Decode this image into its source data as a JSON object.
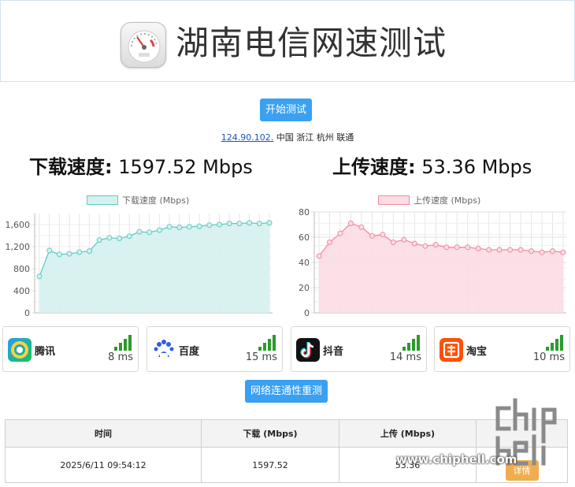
{
  "header": {
    "title": "湖南电信网速测试",
    "logo": "speedometer-icon"
  },
  "controls": {
    "start_label": "开始测试",
    "retest_label": "网络连通性重测"
  },
  "connection": {
    "ip": "124.90.102.",
    "info": "中国 浙江 杭州 联通"
  },
  "download": {
    "label": "下载速度:",
    "value": "1597.52 Mbps"
  },
  "upload": {
    "label": "上传速度:",
    "value": "53.36 Mbps"
  },
  "chart_data": [
    {
      "type": "area",
      "series": [
        {
          "name": "下载速度 (Mbps)",
          "values": [
            660,
            1130,
            1060,
            1070,
            1100,
            1120,
            1320,
            1360,
            1350,
            1390,
            1470,
            1460,
            1500,
            1560,
            1550,
            1560,
            1570,
            1590,
            1600,
            1620,
            1620,
            1630,
            1620,
            1630
          ]
        }
      ],
      "yticks": [
        "0",
        "400",
        "800",
        "1,200",
        "1,600"
      ],
      "ylim": [
        0,
        1800
      ],
      "grid": true,
      "color": "#5ecbc5",
      "fill": "#d5f1ef",
      "legend": "top"
    },
    {
      "type": "area",
      "series": [
        {
          "name": "上传速度 (Mbps)",
          "values": [
            45,
            56,
            63,
            71,
            68,
            61,
            62,
            56,
            58,
            55,
            53,
            54,
            52,
            52,
            52,
            51,
            50,
            50,
            50,
            50,
            49,
            48,
            49,
            48
          ]
        }
      ],
      "yticks": [
        "0",
        "20",
        "40",
        "60",
        "80"
      ],
      "ylim": [
        0,
        80
      ],
      "grid": true,
      "color": "#f18aa0",
      "fill": "#fbdde4",
      "legend": "top"
    }
  ],
  "latency": [
    {
      "name": "腾讯",
      "ms": "8 ms",
      "icon": "tencent-icon"
    },
    {
      "name": "百度",
      "ms": "15 ms",
      "icon": "baidu-icon"
    },
    {
      "name": "抖音",
      "ms": "14 ms",
      "icon": "douyin-icon"
    },
    {
      "name": "淘宝",
      "ms": "10 ms",
      "icon": "taobao-icon"
    }
  ],
  "history": {
    "headers": [
      "时间",
      "下载 (Mbps)",
      "上传 (Mbps)",
      ""
    ],
    "rows": [
      {
        "time": "2025/6/11 09:54:12",
        "download": "1597.52",
        "upload": "53.36",
        "action": "详情"
      }
    ]
  },
  "watermark": {
    "text": "www.chiphell.com",
    "logo": "chiphell-logo"
  }
}
